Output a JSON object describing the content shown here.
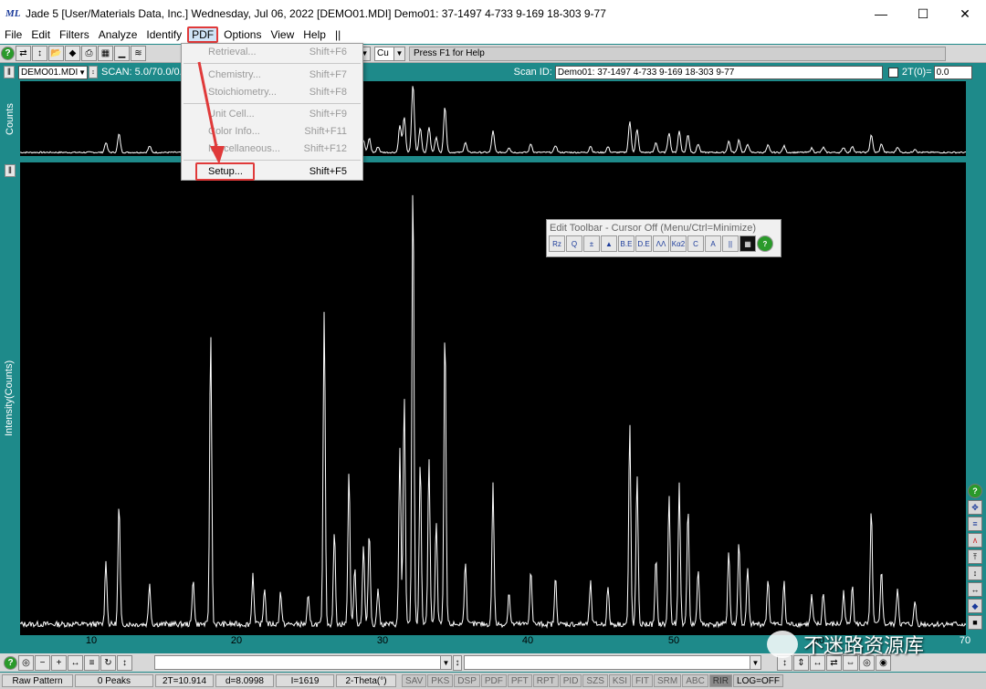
{
  "window": {
    "logo": "ML",
    "title": "Jade 5 [User/Materials Data, Inc.] Wednesday, Jul 06, 2022 [DEMO01.MDI] Demo01: 37-1497 4-733 9-169 18-303 9-77",
    "minimize": "—",
    "maximize": "☐",
    "close": "✕"
  },
  "menubar": {
    "items": [
      {
        "label": "File"
      },
      {
        "label": "Edit"
      },
      {
        "label": "Filters"
      },
      {
        "label": "Analyze"
      },
      {
        "label": "Identify"
      },
      {
        "label": "PDF"
      },
      {
        "label": "Options"
      },
      {
        "label": "View"
      },
      {
        "label": "Help"
      },
      {
        "label": "||"
      }
    ]
  },
  "toolbar": {
    "target": "Cu",
    "help": "Press F1 for Help"
  },
  "scanrow": {
    "file": "DEMO01.MDI",
    "scan": "SCAN: 5.0/70.0/0.",
    "scanid_label": "Scan ID:",
    "scanid_value": "Demo01: 37-1497 4-733 9-169 18-303 9-77",
    "twotheta_label": "2T(0)=",
    "twotheta_value": "0.0"
  },
  "axes": {
    "top_ylabel": "Counts",
    "main_ylabel": "Intensity(Counts)",
    "x_ticks": [
      "10",
      "20",
      "30",
      "40",
      "50",
      "60",
      "70"
    ]
  },
  "pdf_menu": {
    "items": [
      {
        "label": "Retrieval...",
        "shortcut": "Shift+F6",
        "enabled": false
      },
      {
        "label": "Chemistry...",
        "shortcut": "Shift+F7",
        "enabled": false
      },
      {
        "label": "Stoichiometry...",
        "shortcut": "Shift+F8",
        "enabled": false
      },
      {
        "label": "Unit Cell...",
        "shortcut": "Shift+F9",
        "enabled": false
      },
      {
        "label": "Color Info...",
        "shortcut": "Shift+F11",
        "enabled": false
      },
      {
        "label": "Miscellaneous...",
        "shortcut": "Shift+F12",
        "enabled": false
      },
      {
        "label": "Setup...",
        "shortcut": "Shift+F5",
        "enabled": true
      }
    ]
  },
  "edit_toolbar": {
    "title": "Edit Toolbar - Cursor Off (Menu/Ctrl=Minimize)",
    "buttons": [
      "Rz",
      "Q",
      "±",
      "▲",
      "B.E",
      "D.E",
      "ΛΛ",
      "Kα2",
      "C",
      "A",
      "||",
      "▦",
      "?"
    ]
  },
  "status": {
    "pattern": "Raw Pattern",
    "peaks": "0 Peaks",
    "twot": "2T=10.914",
    "d": "d=8.0998",
    "i": "I=1619",
    "mode": "2-Theta(°)",
    "flags": [
      "SAV",
      "PKS",
      "DSP",
      "PDF",
      "PFT",
      "RPT",
      "PID",
      "SZS",
      "KSI",
      "FIT",
      "SRM",
      "ABC",
      "RIR"
    ],
    "log": "LOG=OFF"
  },
  "watermark": "不迷路资源库",
  "chart_data": {
    "type": "line",
    "title": "",
    "xlabel": "",
    "ylabel": "Intensity(Counts)",
    "xlim": [
      5,
      70
    ],
    "ylim": [
      0,
      1
    ],
    "peaks_x": [
      10.9,
      11.8,
      13.9,
      16.9,
      18.1,
      21.0,
      21.8,
      22.9,
      24.8,
      25.9,
      26.6,
      27.6,
      28.0,
      28.6,
      29.0,
      29.6,
      31.1,
      31.4,
      32.0,
      32.5,
      33.1,
      33.6,
      34.2,
      35.6,
      37.5,
      38.6,
      40.1,
      41.8,
      44.2,
      45.4,
      46.9,
      47.4,
      48.7,
      49.6,
      50.3,
      50.9,
      51.6,
      53.7,
      54.4,
      55.0,
      56.4,
      57.5,
      59.4,
      60.2,
      61.6,
      62.2,
      63.5,
      64.2,
      65.3,
      66.5
    ],
    "peaks_y": [
      0.14,
      0.26,
      0.09,
      0.1,
      0.63,
      0.11,
      0.08,
      0.07,
      0.06,
      0.68,
      0.2,
      0.33,
      0.12,
      0.17,
      0.2,
      0.08,
      0.38,
      0.49,
      0.96,
      0.35,
      0.36,
      0.22,
      0.64,
      0.14,
      0.3,
      0.07,
      0.12,
      0.1,
      0.09,
      0.08,
      0.43,
      0.32,
      0.14,
      0.28,
      0.3,
      0.25,
      0.12,
      0.16,
      0.18,
      0.12,
      0.1,
      0.09,
      0.06,
      0.07,
      0.07,
      0.09,
      0.25,
      0.12,
      0.08,
      0.05
    ]
  }
}
